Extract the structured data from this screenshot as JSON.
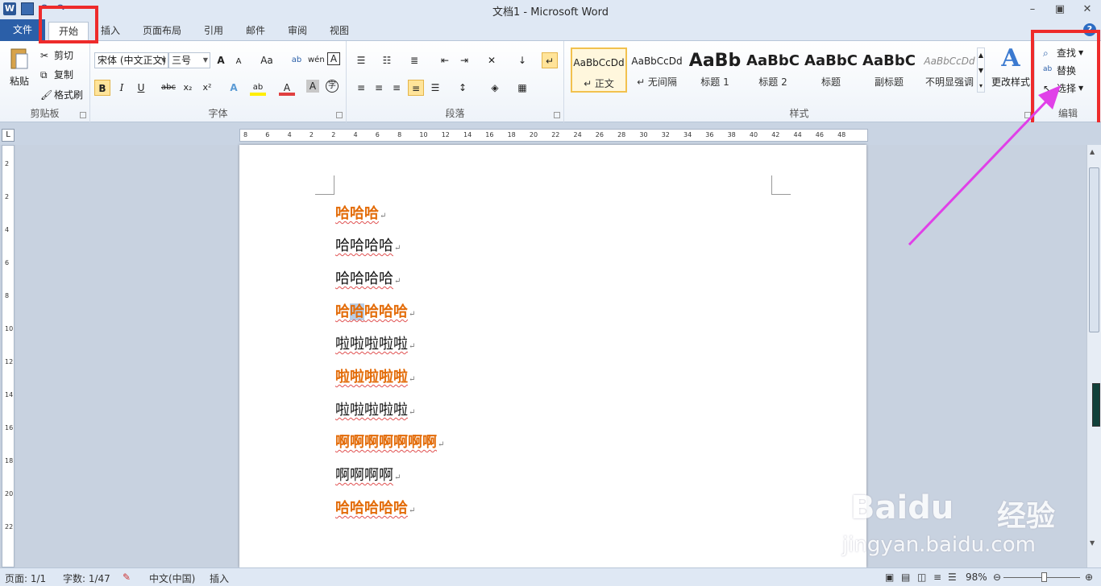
{
  "window": {
    "title": "文档1 - Microsoft Word",
    "minimize": "–",
    "restore": "▣",
    "close": "✕"
  },
  "tabs": {
    "file": "文件",
    "home": "开始",
    "insert": "插入",
    "layout": "页面布局",
    "references": "引用",
    "mailings": "邮件",
    "review": "审阅",
    "view": "视图"
  },
  "clipboard": {
    "paste": "粘贴",
    "cut": "剪切",
    "copy": "复制",
    "format_painter": "格式刷",
    "label": "剪贴板"
  },
  "font": {
    "name": "宋体 (中文正文)",
    "size": "三号",
    "label": "字体",
    "bold": "B",
    "italic": "I",
    "underline": "U",
    "strike": "abc",
    "subscript": "x₂",
    "superscript": "x²",
    "grow": "A",
    "shrink": "A",
    "case": "Aa"
  },
  "paragraph": {
    "label": "段落"
  },
  "styles": {
    "label": "样式",
    "items": [
      {
        "sample": "AaBbCcDd",
        "name": "↵ 正文"
      },
      {
        "sample": "AaBbCcDd",
        "name": "↵ 无间隔"
      },
      {
        "sample": "AaBb",
        "name": "标题 1"
      },
      {
        "sample": "AaBbC",
        "name": "标题 2"
      },
      {
        "sample": "AaBbC",
        "name": "标题"
      },
      {
        "sample": "AaBbC",
        "name": "副标题"
      },
      {
        "sample": "AaBbCcDd",
        "name": "不明显强调"
      }
    ],
    "change": "更改样式"
  },
  "editing": {
    "find": "查找",
    "replace": "替换",
    "select": "选择",
    "label": "编辑"
  },
  "document": {
    "lines": [
      {
        "text": "哈哈哈",
        "style": "orange"
      },
      {
        "text": "哈哈哈哈",
        "style": "black"
      },
      {
        "text": "哈哈哈哈",
        "style": "black"
      },
      {
        "text": "哈哈哈哈哈",
        "style": "orange"
      },
      {
        "text": "啦啦啦啦啦",
        "style": "black"
      },
      {
        "text": "啦啦啦啦啦",
        "style": "orange"
      },
      {
        "text": "啦啦啦啦啦",
        "style": "black"
      },
      {
        "text": "啊啊啊啊啊啊啊",
        "style": "orange"
      },
      {
        "text": "啊啊啊啊",
        "style": "black"
      },
      {
        "text": "哈哈哈哈哈",
        "style": "orange"
      }
    ],
    "para_mark": "↵",
    "line4_first": "哈",
    "line4_selected": "哈",
    "line4_rest": "哈哈哈"
  },
  "ruler": {
    "h": [
      "8",
      "6",
      "4",
      "2",
      "2",
      "4",
      "6",
      "8",
      "10",
      "12",
      "14",
      "16",
      "18",
      "20",
      "22",
      "24",
      "26",
      "28",
      "30",
      "32",
      "34",
      "36",
      "38",
      "40",
      "42",
      "44",
      "46",
      "48"
    ],
    "v": [
      "2",
      "2",
      "4",
      "6",
      "8",
      "10",
      "12",
      "14",
      "16",
      "18",
      "20",
      "22"
    ]
  },
  "status": {
    "page": "页面: 1/1",
    "words": "字数: 1/47",
    "language": "中文(中国)",
    "mode": "插入",
    "zoom": "98%"
  },
  "watermark": {
    "brand": "Baidu",
    "cn": "经验",
    "url": "jingyan.baidu.com"
  },
  "colors": {
    "accent": "#2b5fa8",
    "orange_text": "#e36c09",
    "highlight": "#ee2b2b",
    "arrow": "#e040e8"
  }
}
